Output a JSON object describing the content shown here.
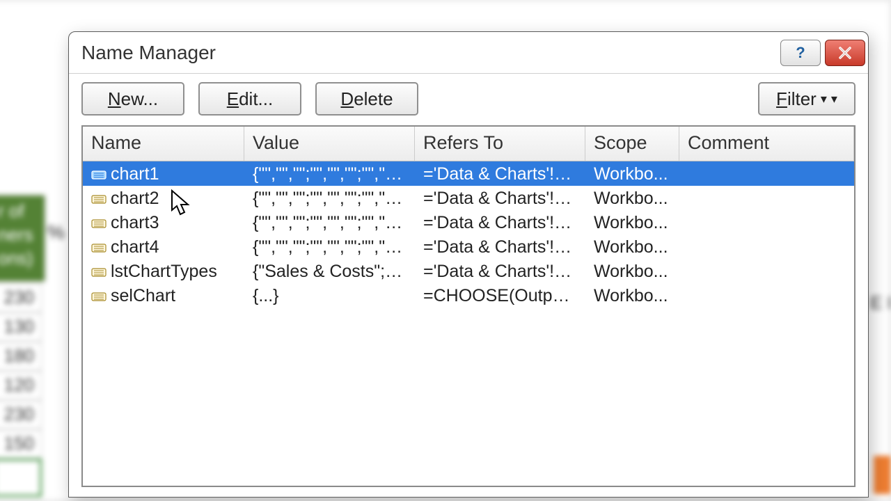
{
  "dialog": {
    "title": "Name Manager",
    "buttons": {
      "new": "New...",
      "edit": "Edit...",
      "delete": "Delete",
      "filter": "Filter"
    },
    "columns": {
      "name": "Name",
      "value": "Value",
      "refersTo": "Refers To",
      "scope": "Scope",
      "comment": "Comment"
    },
    "rows": [
      {
        "name": "chart1",
        "value": "{\"\",\"\",\"\";\"\",\"\",\"\";\"\",\"\",\"\"...",
        "refersTo": "='Data & Charts'!$...",
        "scope": "Workbo...",
        "comment": "",
        "selected": true
      },
      {
        "name": "chart2",
        "value": "{\"\",\"\",\"\";\"\",\"\",\"\";\"\",\"\",\"\"...",
        "refersTo": "='Data & Charts'!$...",
        "scope": "Workbo...",
        "comment": "",
        "selected": false
      },
      {
        "name": "chart3",
        "value": "{\"\",\"\",\"\";\"\",\"\",\"\";\"\",\"\",\"\"...",
        "refersTo": "='Data & Charts'!$...",
        "scope": "Workbo...",
        "comment": "",
        "selected": false
      },
      {
        "name": "chart4",
        "value": "{\"\",\"\",\"\";\"\",\"\",\"\";\"\",\"\",\"\"...",
        "refersTo": "='Data & Charts'!$...",
        "scope": "Workbo...",
        "comment": "",
        "selected": false
      },
      {
        "name": "lstChartTypes",
        "value": "{\"Sales & Costs\";\"Pr...",
        "refersTo": "='Data & Charts'!$...",
        "scope": "Workbo...",
        "comment": "",
        "selected": false
      },
      {
        "name": "selChart",
        "value": "{...}",
        "refersTo": "=CHOOSE(Output!...",
        "scope": "Workbo...",
        "comment": "",
        "selected": false
      }
    ]
  },
  "background": {
    "greenHeader": "r of\nners\nons)",
    "pct": "%",
    "cells": [
      "230",
      "130",
      "180",
      "120",
      "230",
      "150"
    ],
    "rightFragment": "E I"
  }
}
